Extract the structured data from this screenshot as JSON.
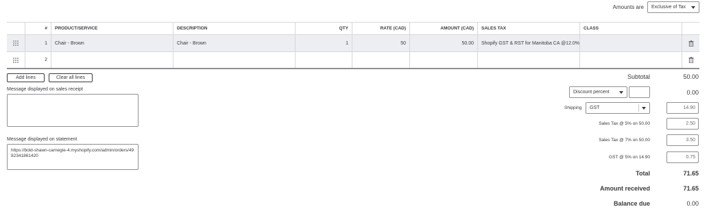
{
  "amounts": {
    "label": "Amounts are",
    "selected": "Exclusive of Tax"
  },
  "table": {
    "headers": {
      "num": "#",
      "product": "PRODUCT/SERVICE",
      "description": "DESCRIPTION",
      "qty": "QTY",
      "rate": "RATE (CAD)",
      "amount": "AMOUNT (CAD)",
      "sales_tax": "SALES TAX",
      "class": "CLASS"
    },
    "rows": [
      {
        "num": "1",
        "product": "Chair - Brown",
        "description": "Chair - Brown",
        "qty": "1",
        "rate": "50",
        "amount": "50.00",
        "sales_tax": "Shopify GST & RST for Manitoba CA @12.0%",
        "class": ""
      },
      {
        "num": "2",
        "product": "",
        "description": "",
        "qty": "",
        "rate": "",
        "amount": "",
        "sales_tax": "",
        "class": ""
      }
    ]
  },
  "buttons": {
    "add_lines": "Add lines",
    "clear_all_lines": "Clear all lines"
  },
  "messages": {
    "receipt_label": "Message displayed on sales receipt",
    "receipt_value": "",
    "statement_label": "Message displayed on statement",
    "statement_value": "https://bold-shawn-carnegie-4.myshopify.com/admin/orders/4982341861420"
  },
  "summary": {
    "subtotal_label": "Subtotal",
    "subtotal_value": "50.00",
    "discount_type": "Discount percent",
    "discount_input": "",
    "discount_value": "0.00",
    "shipping_label": "Shipping",
    "shipping_tax": "GST",
    "shipping_value": "14.90",
    "tax_lines": [
      {
        "label": "Sales Tax @ 5% on 50.00",
        "value": "2.50"
      },
      {
        "label": "Sales Tax @ 7% on 50.00",
        "value": "3.50"
      },
      {
        "label": "GST @ 5% on 14.90",
        "value": "0.75"
      }
    ],
    "total_label": "Total",
    "total_value": "71.65",
    "amount_received_label": "Amount received",
    "amount_received_value": "71.65",
    "balance_due_label": "Balance due",
    "balance_due_value": "0.00"
  }
}
